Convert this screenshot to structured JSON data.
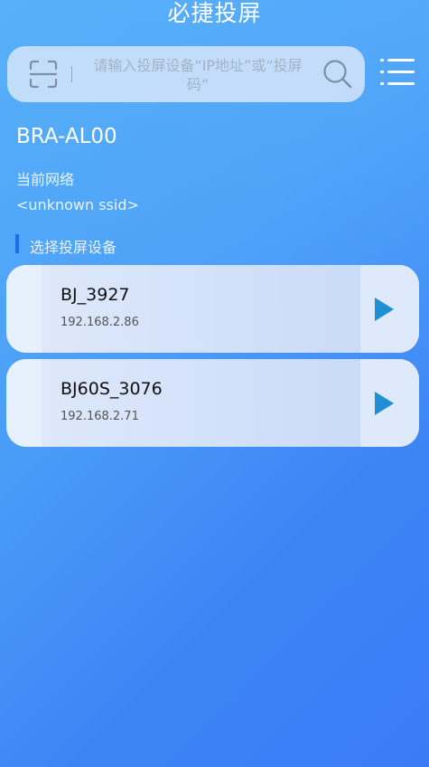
{
  "app": {
    "title": "必捷投屏"
  },
  "search": {
    "placeholder": "请输入投屏设备“IP地址”或“投屏码”"
  },
  "device": {
    "model": "BRA-AL00"
  },
  "network": {
    "label": "当前网络",
    "ssid": "<unknown ssid>"
  },
  "section": {
    "title": "选择投屏设备"
  },
  "devices": [
    {
      "name": "BJ_3927",
      "ip": "192.168.2.86"
    },
    {
      "name": "BJ60S_3076",
      "ip": "192.168.2.71"
    }
  ],
  "colors": {
    "accent": "#1a6ff0",
    "play": "#1e8fd4"
  },
  "icons": {
    "scan": "scan-icon",
    "search": "search-icon",
    "menu": "menu-icon",
    "play": "play-icon"
  }
}
